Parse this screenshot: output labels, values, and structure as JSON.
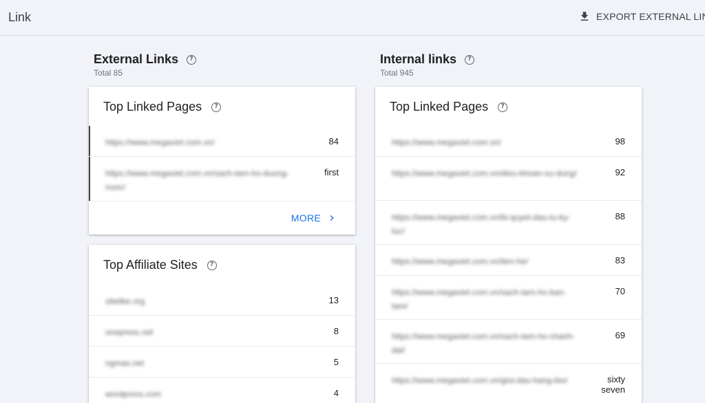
{
  "header": {
    "title": "Link",
    "export_label": "EXPORT EXTERNAL LINK"
  },
  "external": {
    "title": "External Links",
    "total": "Total 85",
    "top_linked": {
      "title": "Top Linked Pages",
      "rows": [
        {
          "url": "https://www.megaviet.com.vn/",
          "count": "84"
        },
        {
          "url": "https://www.megaviet.com.vn/sach-tam-ho-duong-nuoc/",
          "count": "first"
        }
      ],
      "more_label": "MORE"
    },
    "top_affiliate": {
      "title": "Top Affiliate Sites",
      "rows": [
        {
          "url": "sitelike.org",
          "count": "13"
        },
        {
          "url": "onepress.net",
          "count": "8"
        },
        {
          "url": "ngmax.net",
          "count": "5"
        },
        {
          "url": "wordpress.com",
          "count": "4"
        }
      ]
    }
  },
  "internal": {
    "title": "Internal links",
    "total": "Total 945",
    "top_linked": {
      "title": "Top Linked Pages",
      "rows": [
        {
          "url": "https://www.megaviet.com.vn/",
          "count": "98"
        },
        {
          "url": "https://www.megaviet.com.vn/dieu-khoan-su-dung/",
          "count": "92"
        },
        {
          "url": "https://www.megaviet.com.vn/bi-quyet-dau-tu-ky-luc/",
          "count": "88"
        },
        {
          "url": "https://www.megaviet.com.vn/lien-he/",
          "count": "83"
        },
        {
          "url": "https://www.megaviet.com.vn/sach-tam-ho-ban-tam/",
          "count": "70"
        },
        {
          "url": "https://www.megaviet.com.vn/sach-tam-ho-chanh-dai/",
          "count": "69"
        },
        {
          "url": "https://www.megaviet.com.vn/gioi-dau-hang-bio/",
          "count": "sixty seven"
        }
      ]
    }
  },
  "icons": {
    "download": "download-icon",
    "help": "help-circle-icon",
    "chevron": "chevron-right-icon"
  },
  "colors": {
    "accent": "#1a73e8",
    "background": "#f1f3f8"
  }
}
